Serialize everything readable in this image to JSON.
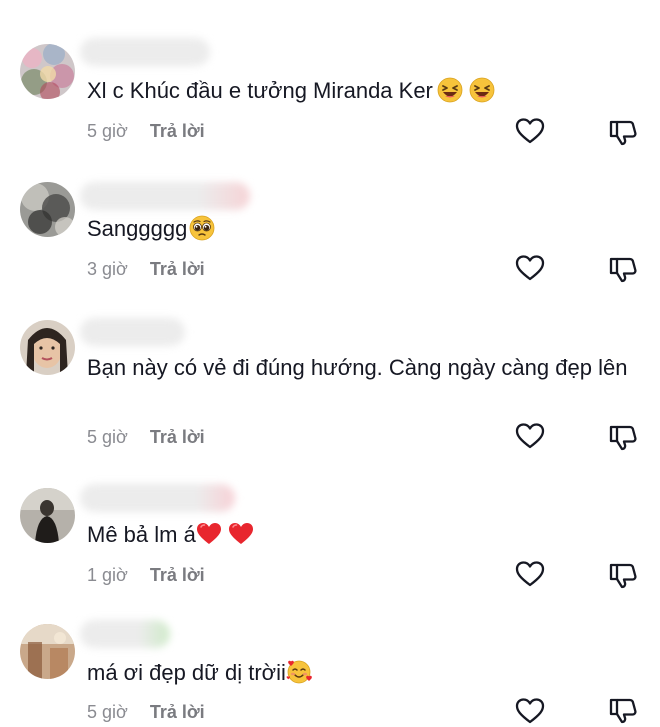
{
  "comments": [
    {
      "text": "Xl c Khúc đầu e tưởng Miranda Ker",
      "emojis": [
        "laughing-face",
        "laughing-face"
      ],
      "time": "5 giờ",
      "reply": "Trả lời"
    },
    {
      "text": "Sanggggg",
      "emojis": [
        "pleading-face"
      ],
      "time": "3 giờ",
      "reply": "Trả lời"
    },
    {
      "text": "Bạn này có vẻ đi đúng hướng. Càng ngày càng đẹp lên",
      "emojis": [],
      "time": "5 giờ",
      "reply": "Trả lời"
    },
    {
      "text": "Mê bả lm á",
      "emojis": [
        "red-heart",
        "red-heart"
      ],
      "time": "1 giờ",
      "reply": "Trả lời"
    },
    {
      "text": "má ơi đẹp dữ dị trờii",
      "emojis": [
        "smiling-face-with-hearts"
      ],
      "time": "5 giờ",
      "reply": "Trả lời"
    }
  ],
  "icons": {
    "like": "heart-outline-icon",
    "dislike": "thumbs-down-outline-icon"
  },
  "colors": {
    "text": "#161823",
    "meta": "#8a8b91",
    "icon_stroke": "#161823"
  }
}
